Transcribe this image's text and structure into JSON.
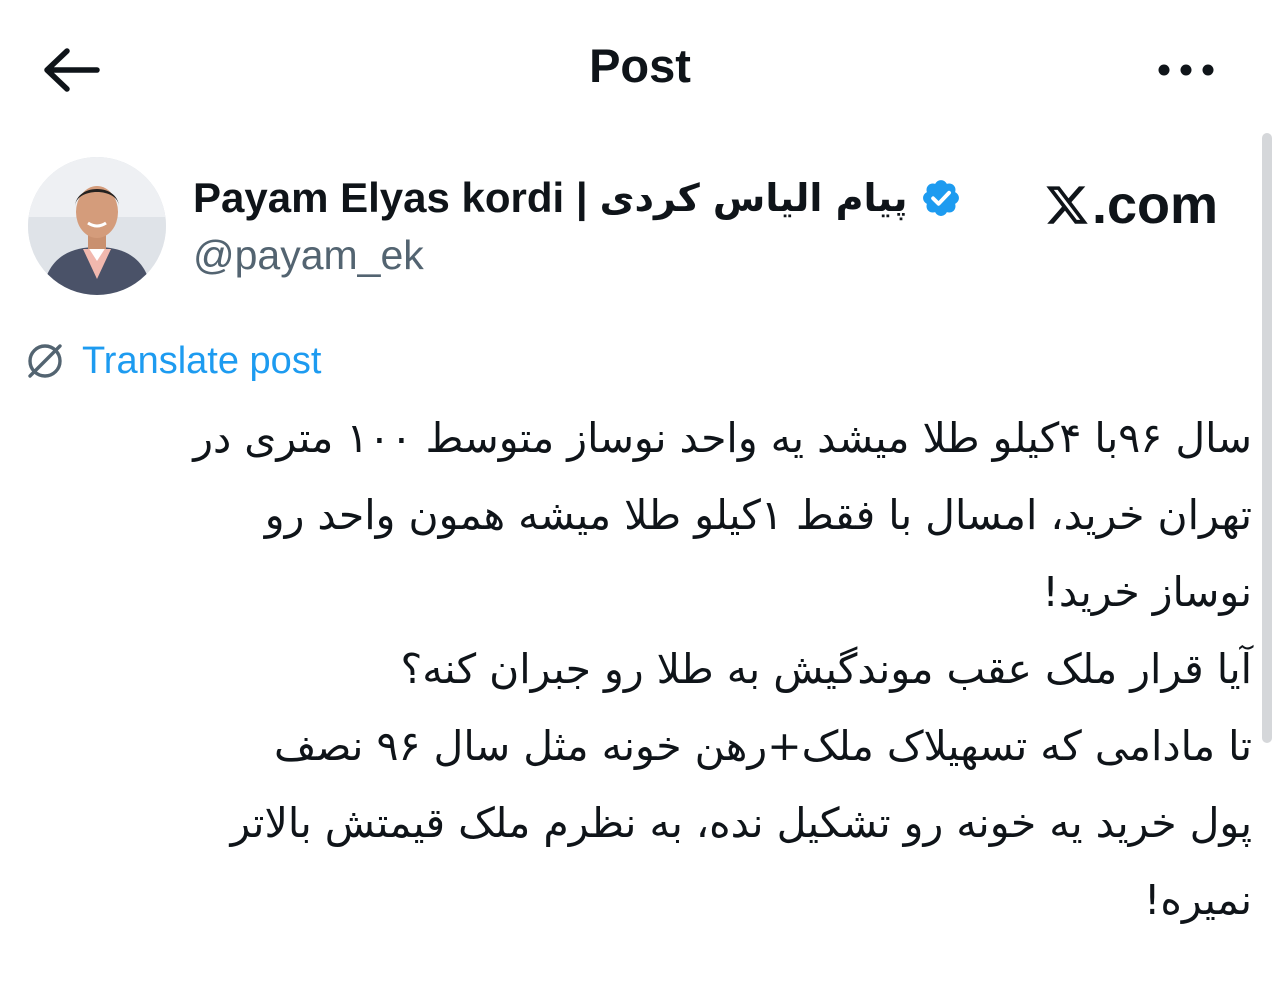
{
  "header": {
    "title": "Post",
    "back_icon": "arrow-left-icon",
    "more_icon": "ellipsis-horizontal-icon"
  },
  "author": {
    "display_name": "Payam Elyas kordi |",
    "display_name_fa": "پیام الیاس کردی",
    "verified": true,
    "verified_color": "#1d9bf0",
    "handle": "@payam_ek",
    "avatar_icon": "profile-photo"
  },
  "watermark": {
    "text": ".com",
    "logo_icon": "x-logo-icon"
  },
  "translate": {
    "label": "Translate post",
    "icon": "globe-icon",
    "color": "#1d9bf0"
  },
  "post": {
    "lines": [
      "سال ۹۶با ۴کیلو طلا میشد یه واحد نوساز متوسط ۱۰۰ متری در",
      "تهران خرید، امسال با فقط ۱کیلو طلا میشه همون واحد رو",
      "نوساز خرید!",
      "آیا قرار ملک عقب موندگیش به طلا رو جبران کنه؟",
      "تا مادامی که تسهیلاک ملک+رهن خونه مثل سال ۹۶ نصف",
      "پول خرید یه خونه رو تشکیل نده، به نظرم ملک قیمتش بالاتر",
      "نمیره!"
    ]
  }
}
